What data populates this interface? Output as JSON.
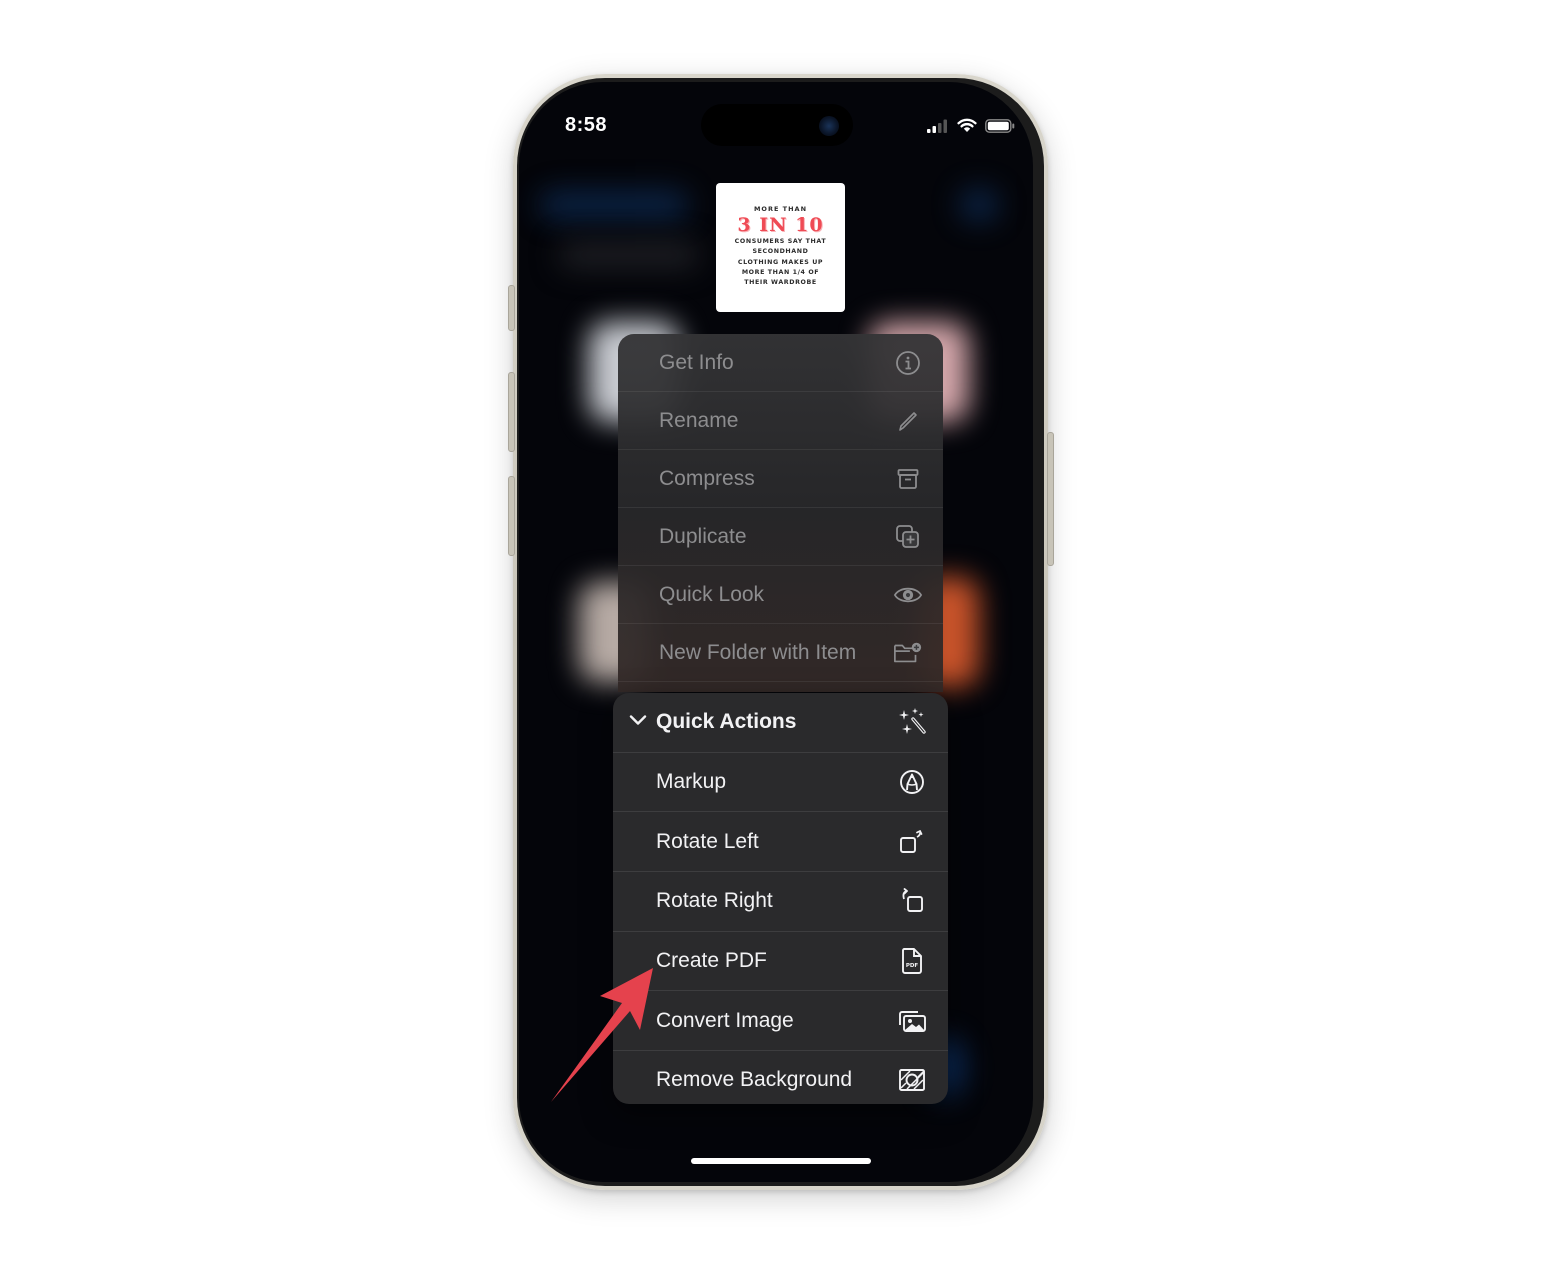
{
  "status_bar": {
    "time": "8:58",
    "icons": [
      "cellular-signal-icon",
      "wifi-icon",
      "battery-icon"
    ]
  },
  "preview": {
    "line_top": "MORE THAN",
    "headline": "3 IN 10",
    "body_lines": [
      "CONSUMERS SAY THAT",
      "SECONDHAND",
      "CLOTHING MAKES UP",
      "MORE THAN 1/4 OF",
      "THEIR WARDROBE"
    ],
    "headline_color": "#ef4b55"
  },
  "context_menu": {
    "items": [
      {
        "label": "Get Info",
        "icon": "info-circle-icon"
      },
      {
        "label": "Rename",
        "icon": "pencil-icon"
      },
      {
        "label": "Compress",
        "icon": "archive-box-icon"
      },
      {
        "label": "Duplicate",
        "icon": "duplicate-plus-icon"
      },
      {
        "label": "Quick Look",
        "icon": "eye-icon"
      },
      {
        "label": "New Folder with Item",
        "icon": "folder-badge-plus-icon"
      }
    ]
  },
  "quick_actions": {
    "header": {
      "label": "Quick Actions",
      "icon": "magic-wand-sparkles-icon",
      "expanded": true
    },
    "items": [
      {
        "label": "Markup",
        "icon": "markup-pen-circle-icon"
      },
      {
        "label": "Rotate Left",
        "icon": "rotate-left-icon"
      },
      {
        "label": "Rotate Right",
        "icon": "rotate-right-icon"
      },
      {
        "label": "Create PDF",
        "icon": "pdf-document-icon"
      },
      {
        "label": "Convert Image",
        "icon": "photo-stack-icon"
      },
      {
        "label": "Remove Background",
        "icon": "remove-background-icon"
      }
    ]
  },
  "annotation": {
    "arrow_color": "#e5424d",
    "points_to": "Create PDF"
  }
}
